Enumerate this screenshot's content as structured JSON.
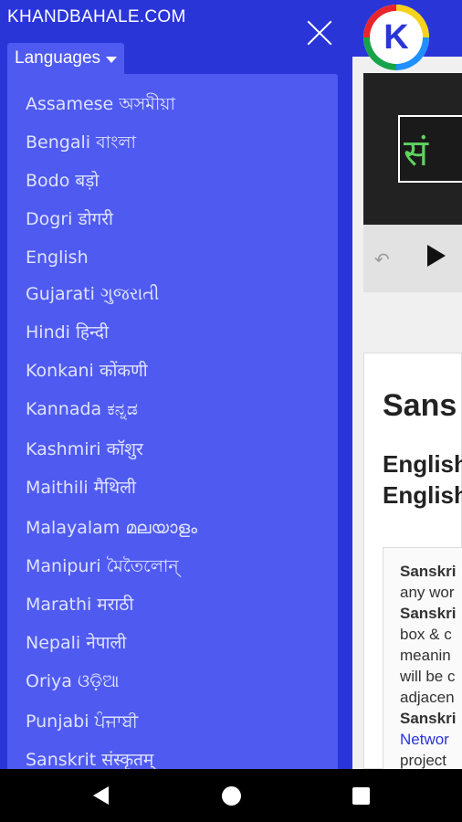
{
  "drawer": {
    "brand": "KHANDBAHALE.COM",
    "languages_label": "Languages",
    "items": [
      "Assamese অসমীয়া",
      "Bengali বাংলা",
      "Bodo बड़ो",
      "Dogri डोगरी",
      "English",
      "Gujarati ગુજરાતી",
      "Hindi हिन्दी",
      "Konkani कोंकणी",
      "Kannada ಕನ್ನಡ",
      "Kashmiri कॉशुर",
      "Maithili मैथिली",
      "Malayalam മലയാളം",
      "Manipuri মৈতৈলোন্",
      "Marathi मराठी",
      "Nepali नेपाली",
      "Oriya ଓଡ଼ିଆ",
      "Punjabi ਪੰਜਾਬੀ",
      "Sanskrit संस्कृतम्"
    ]
  },
  "background": {
    "brand_letter": "K",
    "logo_letter": "K",
    "video_sign": "सं",
    "title": "Sans",
    "subtitle_line1": "English",
    "subtitle_line2": "English",
    "card_lines": [
      "Sanskri",
      "any wor",
      "Sanskri",
      "box & c",
      "meanin",
      "will be c",
      "adjacen",
      "Sanskri",
      "Networ",
      "project"
    ]
  },
  "colors": {
    "drawer_bg": "#2a35d8",
    "panel_bg": "#4f5af0",
    "item_text": "#dfe3ff"
  },
  "icons": {
    "close": "close-icon",
    "caret": "caret-down-icon",
    "back": "back-icon",
    "home": "home-icon",
    "recents": "recents-icon"
  }
}
